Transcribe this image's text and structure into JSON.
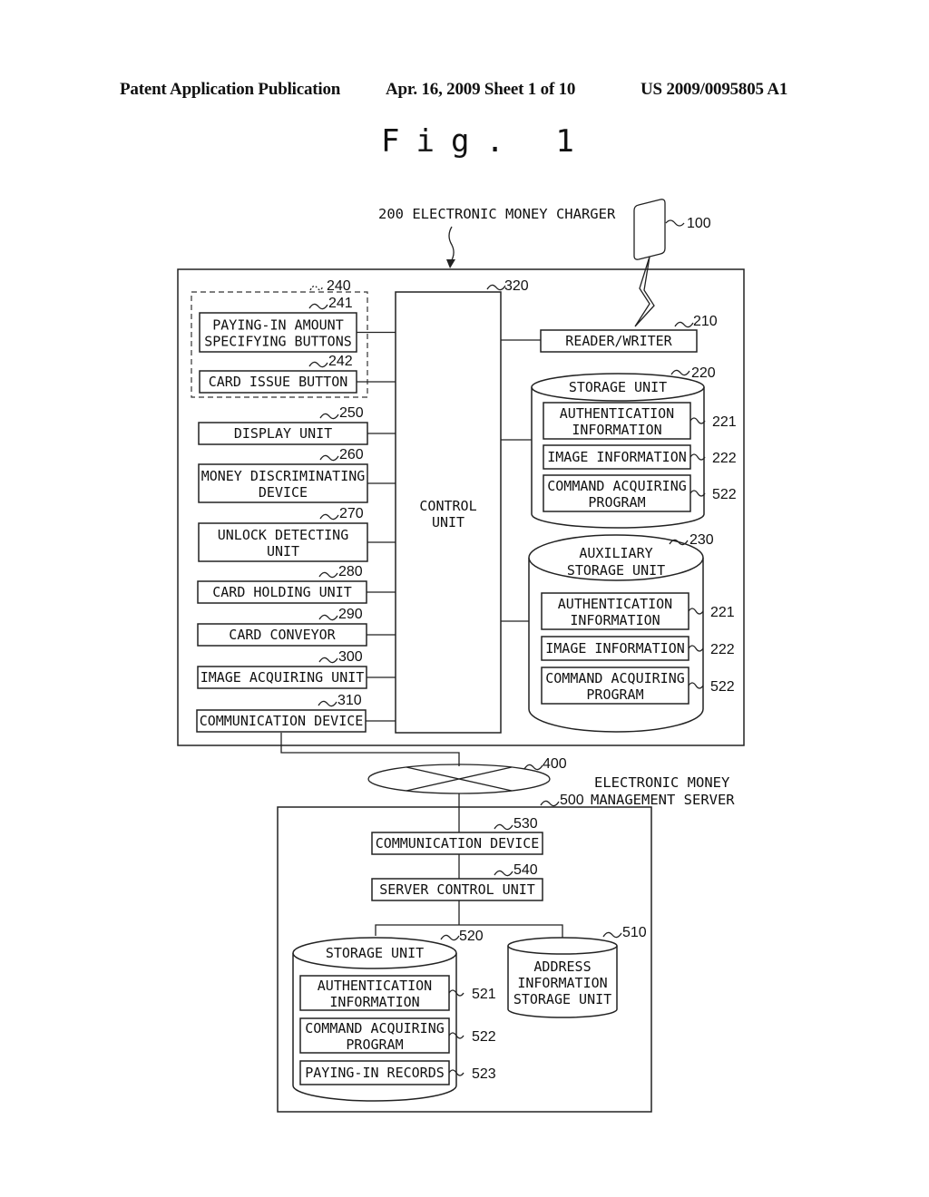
{
  "header": {
    "left": "Patent Application Publication",
    "middle": "Apr. 16, 2009  Sheet 1 of 10",
    "right": "US 2009/0095805 A1"
  },
  "figure_title": "Fig. 1",
  "charger": {
    "title": "200 ELECTRONIC MONEY CHARGER",
    "card_ref": "100",
    "button_group_ref": "240",
    "left_blocks": [
      {
        "ref": "241",
        "lines": [
          "PAYING-IN AMOUNT",
          "SPECIFYING BUTTONS"
        ]
      },
      {
        "ref": "242",
        "lines": [
          "CARD ISSUE BUTTON"
        ]
      },
      {
        "ref": "250",
        "lines": [
          "DISPLAY UNIT"
        ]
      },
      {
        "ref": "260",
        "lines": [
          "MONEY DISCRIMINATING",
          "DEVICE"
        ]
      },
      {
        "ref": "270",
        "lines": [
          "UNLOCK DETECTING",
          "UNIT"
        ]
      },
      {
        "ref": "280",
        "lines": [
          "CARD HOLDING UNIT"
        ]
      },
      {
        "ref": "290",
        "lines": [
          "CARD CONVEYOR"
        ]
      },
      {
        "ref": "300",
        "lines": [
          "IMAGE ACQUIRING UNIT"
        ]
      },
      {
        "ref": "310",
        "lines": [
          "COMMUNICATION DEVICE"
        ]
      }
    ],
    "control_unit": {
      "ref": "320",
      "lines": [
        "CONTROL",
        "UNIT"
      ]
    },
    "reader_writer": {
      "ref": "210",
      "label": "READER/WRITER"
    },
    "storage_unit": {
      "ref": "220",
      "title_lines": [
        "STORAGE UNIT"
      ],
      "items": [
        {
          "ref": "221",
          "lines": [
            "AUTHENTICATION",
            "INFORMATION"
          ]
        },
        {
          "ref": "222",
          "lines": [
            "IMAGE INFORMATION"
          ]
        },
        {
          "ref": "522",
          "lines": [
            "COMMAND ACQUIRING",
            "PROGRAM"
          ]
        }
      ]
    },
    "aux_storage_unit": {
      "ref": "230",
      "title_lines": [
        "AUXILIARY",
        "STORAGE UNIT"
      ],
      "items": [
        {
          "ref": "221",
          "lines": [
            "AUTHENTICATION",
            "INFORMATION"
          ]
        },
        {
          "ref": "222",
          "lines": [
            "IMAGE INFORMATION"
          ]
        },
        {
          "ref": "522",
          "lines": [
            "COMMAND ACQUIRING",
            "PROGRAM"
          ]
        }
      ]
    }
  },
  "network": {
    "ref": "400"
  },
  "server": {
    "ref": "500",
    "title_lines": [
      "ELECTRONIC MONEY",
      "MANAGEMENT SERVER"
    ],
    "communication_device": {
      "ref": "530",
      "label": "COMMUNICATION DEVICE"
    },
    "server_control_unit": {
      "ref": "540",
      "label": "SERVER CONTROL UNIT"
    },
    "storage_unit": {
      "ref": "520",
      "title": "STORAGE UNIT",
      "items": [
        {
          "ref": "521",
          "lines": [
            "AUTHENTICATION",
            "INFORMATION"
          ]
        },
        {
          "ref": "522",
          "lines": [
            "COMMAND ACQUIRING",
            "PROGRAM"
          ]
        },
        {
          "ref": "523",
          "lines": [
            "PAYING-IN RECORDS"
          ]
        }
      ]
    },
    "address_storage": {
      "ref": "510",
      "lines": [
        "ADDRESS",
        "INFORMATION",
        "STORAGE UNIT"
      ]
    }
  }
}
